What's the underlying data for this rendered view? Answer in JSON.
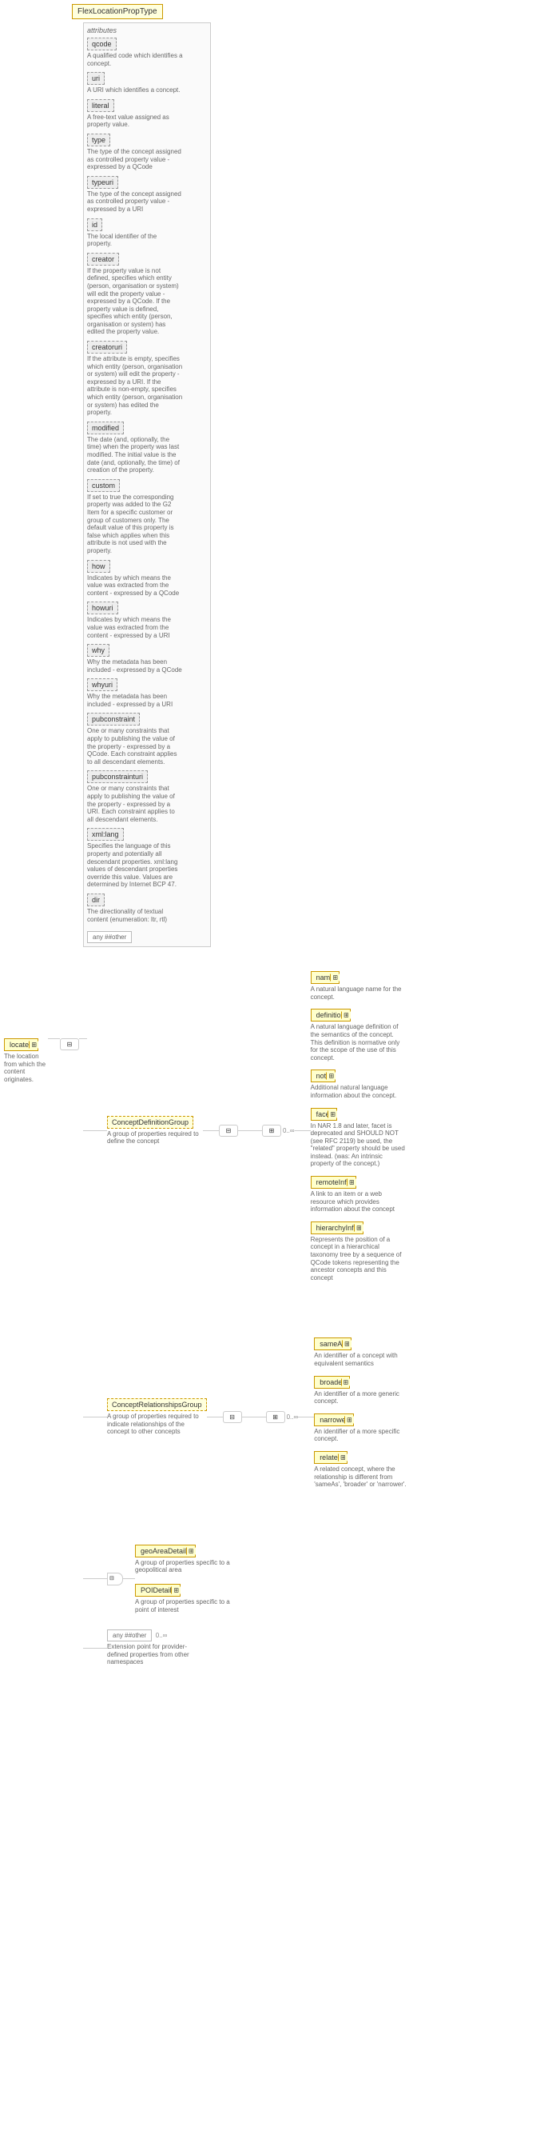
{
  "typeName": "FlexLocationPropType",
  "rootElement": {
    "name": "located",
    "desc": "The location from which the content originates."
  },
  "attributesLabel": "attributes",
  "attrs": [
    {
      "name": "qcode",
      "desc": "A qualified code which identifies a concept."
    },
    {
      "name": "uri",
      "desc": "A URI which identifies a concept."
    },
    {
      "name": "literal",
      "desc": "A free-text value assigned as property value."
    },
    {
      "name": "type",
      "desc": "The type of the concept assigned as controlled property value - expressed by a QCode"
    },
    {
      "name": "typeuri",
      "desc": "The type of the concept assigned as controlled property value - expressed by a URI"
    },
    {
      "name": "id",
      "desc": "The local identifier of the property."
    },
    {
      "name": "creator",
      "desc": "If the property value is not defined, specifies which entity (person, organisation or system) will edit the property value - expressed by a QCode. If the property value is defined, specifies which entity (person, organisation or system) has edited the property value."
    },
    {
      "name": "creatoruri",
      "desc": "If the attribute is empty, specifies which entity (person, organisation or system) will edit the property - expressed by a URI. If the attribute is non-empty, specifies which entity (person, organisation or system) has edited the property."
    },
    {
      "name": "modified",
      "desc": "The date (and, optionally, the time) when the property was last modified. The initial value is the date (and, optionally, the time) of creation of the property."
    },
    {
      "name": "custom",
      "desc": "If set to true the corresponding property was added to the G2 Item for a specific customer or group of customers only. The default value of this property is false which applies when this attribute is not used with the property."
    },
    {
      "name": "how",
      "desc": "Indicates by which means the value was extracted from the content - expressed by a QCode"
    },
    {
      "name": "howuri",
      "desc": "Indicates by which means the value was extracted from the content - expressed by a URI"
    },
    {
      "name": "why",
      "desc": "Why the metadata has been included - expressed by a QCode"
    },
    {
      "name": "whyuri",
      "desc": "Why the metadata has been included - expressed by a URI"
    },
    {
      "name": "pubconstraint",
      "desc": "One or many constraints that apply to publishing the value of the property - expressed by a QCode. Each constraint applies to all descendant elements."
    },
    {
      "name": "pubconstrainturi",
      "desc": "One or many constraints that apply to publishing the value of the property - expressed by a URI. Each constraint applies to all descendant elements."
    },
    {
      "name": "xml:lang",
      "desc": "Specifies the language of this property and potentially all descendant properties. xml:lang values of descendant properties override this value. Values are determined by Internet BCP 47."
    },
    {
      "name": "dir",
      "desc": "The directionality of textual content (enumeration: ltr, rtl)"
    }
  ],
  "anyOther": "any ##other",
  "groups": {
    "defGroup": {
      "name": "ConceptDefinitionGroup",
      "desc": "A group of properties required to define the concept",
      "card": "0..∞"
    },
    "relGroup": {
      "name": "ConceptRelationshipsGroup",
      "desc": "A group of properties required to indicate relationships of the concept to other concepts",
      "card": "0..∞"
    },
    "geoGroup": {
      "name": "geoAreaDetails",
      "desc": "A group of properties specific to a geopolitical area"
    },
    "poiGroup": {
      "name": "POIDetails",
      "desc": "A group of properties specific to a point of interest"
    }
  },
  "defChildren": [
    {
      "name": "name",
      "desc": "A natural language name for the concept."
    },
    {
      "name": "definition",
      "desc": "A natural language definition of the semantics of the concept. This definition is normative only for the scope of the use of this concept."
    },
    {
      "name": "note",
      "desc": "Additional natural language information about the concept."
    },
    {
      "name": "facet",
      "desc": "In NAR 1.8 and later, facet is deprecated and SHOULD NOT (see RFC 2119) be used, the \"related\" property should be used instead. (was: An intrinsic property of the concept.)"
    },
    {
      "name": "remoteInfo",
      "desc": "A link to an item or a web resource which provides information about the concept"
    },
    {
      "name": "hierarchyInfo",
      "desc": "Represents the position of a concept in a hierarchical taxonomy tree by a sequence of QCode tokens representing the ancestor concepts and this concept"
    }
  ],
  "relChildren": [
    {
      "name": "sameAs",
      "desc": "An identifier of a concept with equivalent semantics"
    },
    {
      "name": "broader",
      "desc": "An identifier of a more generic concept."
    },
    {
      "name": "narrower",
      "desc": "An identifier of a more specific concept."
    },
    {
      "name": "related",
      "desc": "A related concept, where the relationship is different from 'sameAs', 'broader' or 'narrower'."
    }
  ],
  "extensionPoint": {
    "name": "any ##other",
    "card": "0..∞",
    "desc": "Extension point for provider-defined properties from other namespaces"
  }
}
